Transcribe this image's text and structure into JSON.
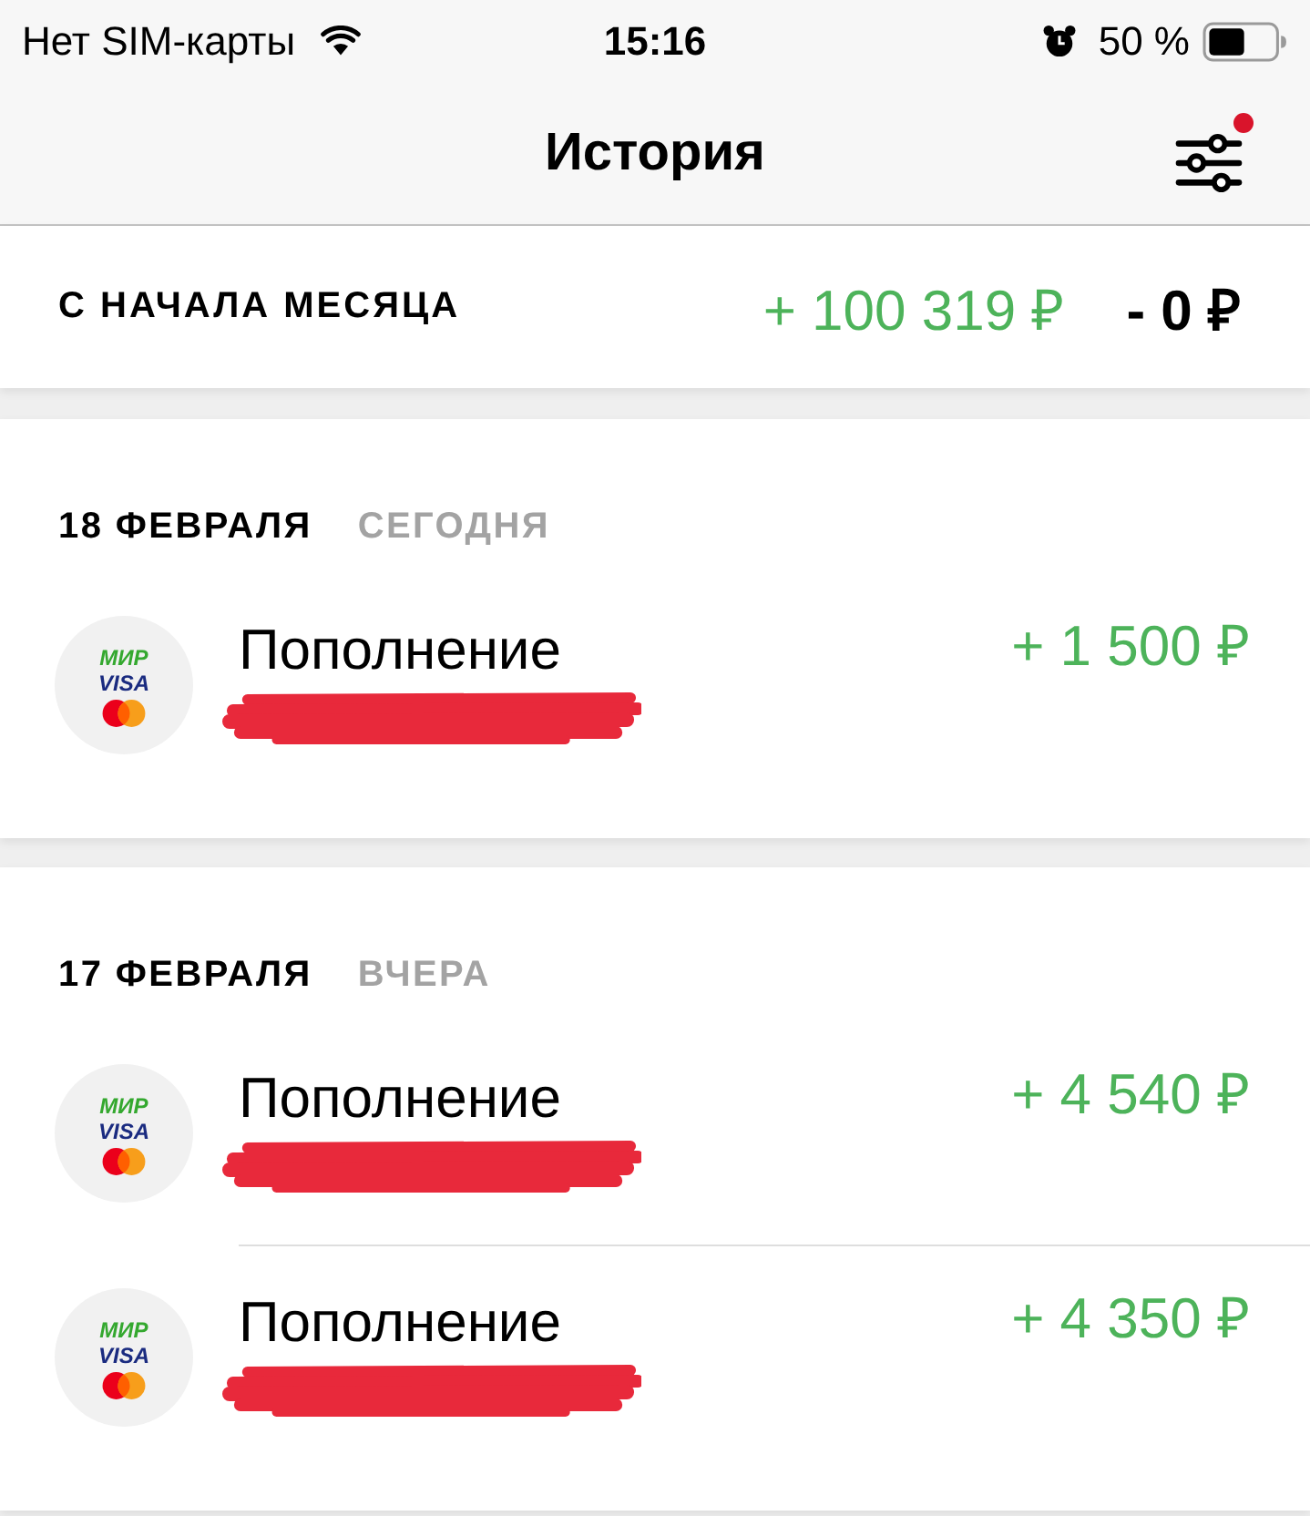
{
  "status_bar": {
    "carrier": "Нет SIM-карты",
    "time": "15:16",
    "battery": "50 %"
  },
  "header": {
    "title": "История",
    "filter_badge": true
  },
  "summary": {
    "label": "С НАЧАЛА МЕСЯЦА",
    "income": "+ 100 319 ₽",
    "expense": "- 0 ₽"
  },
  "days": [
    {
      "date": "18 ФЕВРАЛЯ",
      "relative": "СЕГОДНЯ",
      "transactions": [
        {
          "title": "Пополнение",
          "amount": "+ 1 500 ₽",
          "kind": "income",
          "logos": [
            {
              "kind": "mir",
              "text": "МИР"
            },
            {
              "kind": "visa",
              "text": "VISA"
            }
          ],
          "redacted": true
        }
      ]
    },
    {
      "date": "17 ФЕВРАЛЯ",
      "relative": "ВЧЕРА",
      "transactions": [
        {
          "title": "Пополнение",
          "amount": "+ 4 540 ₽",
          "kind": "income",
          "logos": [
            {
              "kind": "mir",
              "text": "МИР"
            },
            {
              "kind": "visa",
              "text": "VISA"
            }
          ],
          "redacted": true
        },
        {
          "title": "Пополнение",
          "amount": "+ 4 350 ₽",
          "kind": "income",
          "logos": [
            {
              "kind": "mir",
              "text": "МИР"
            },
            {
              "kind": "visa",
              "text": "VISA"
            }
          ],
          "redacted": true
        }
      ]
    }
  ]
}
